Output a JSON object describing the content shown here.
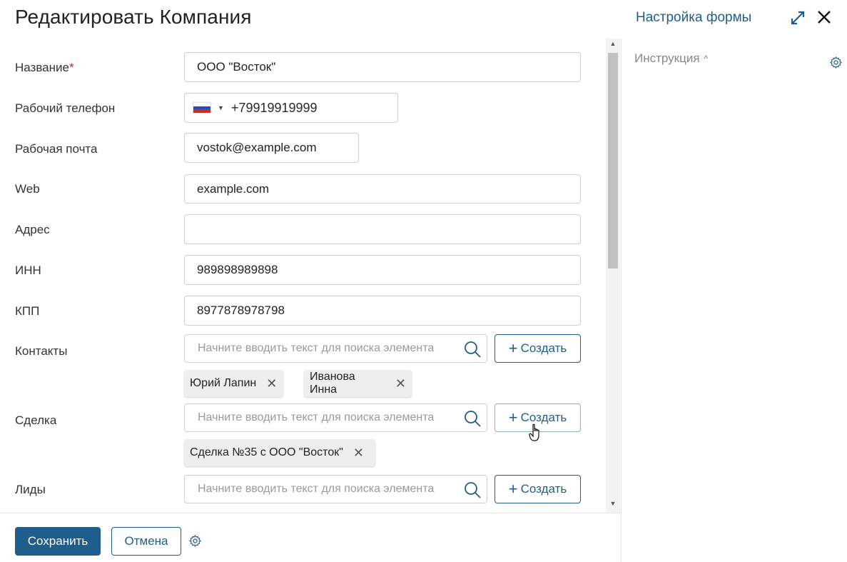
{
  "header": {
    "title": "Редактировать Компания",
    "form_settings": "Настройка формы"
  },
  "fields": {
    "name": {
      "label": "Название",
      "required_mark": "*",
      "value": "ООО \"Восток\""
    },
    "phone": {
      "label": "Рабочий телефон",
      "value": "+79919919999",
      "country": "RU"
    },
    "email": {
      "label": "Рабочая почта",
      "value": "vostok@example.com"
    },
    "web": {
      "label": "Web",
      "value": "example.com"
    },
    "address": {
      "label": "Адрес",
      "value": ""
    },
    "inn": {
      "label": "ИНН",
      "value": "989898989898"
    },
    "kpp": {
      "label": "КПП",
      "value": "8977878978798"
    }
  },
  "contacts": {
    "label": "Контакты",
    "placeholder": "Начните вводить текст для поиска элемента",
    "create_label": "Создать",
    "tags": [
      "Юрий Лапин",
      "Иванова Инна"
    ]
  },
  "deal": {
    "label": "Сделка",
    "placeholder": "Начните вводить текст для поиска элемента",
    "create_label": "Создать",
    "tags": [
      "Сделка №35 с ООО \"Восток\""
    ]
  },
  "leads": {
    "label": "Лиды",
    "placeholder": "Начните вводить текст для поиска элемента",
    "create_label": "Создать"
  },
  "sidebar": {
    "instruction": "Инструкция"
  },
  "footer": {
    "save": "Сохранить",
    "cancel": "Отмена"
  },
  "colors": {
    "accent": "#1f5e8c",
    "flag_white": "#ffffff",
    "flag_blue": "#1c4fbf",
    "flag_red": "#d52b1e"
  },
  "icons": [
    "expand-icon",
    "close-icon",
    "search-icon",
    "gear-icon",
    "remove-icon",
    "hand-cursor-icon"
  ]
}
